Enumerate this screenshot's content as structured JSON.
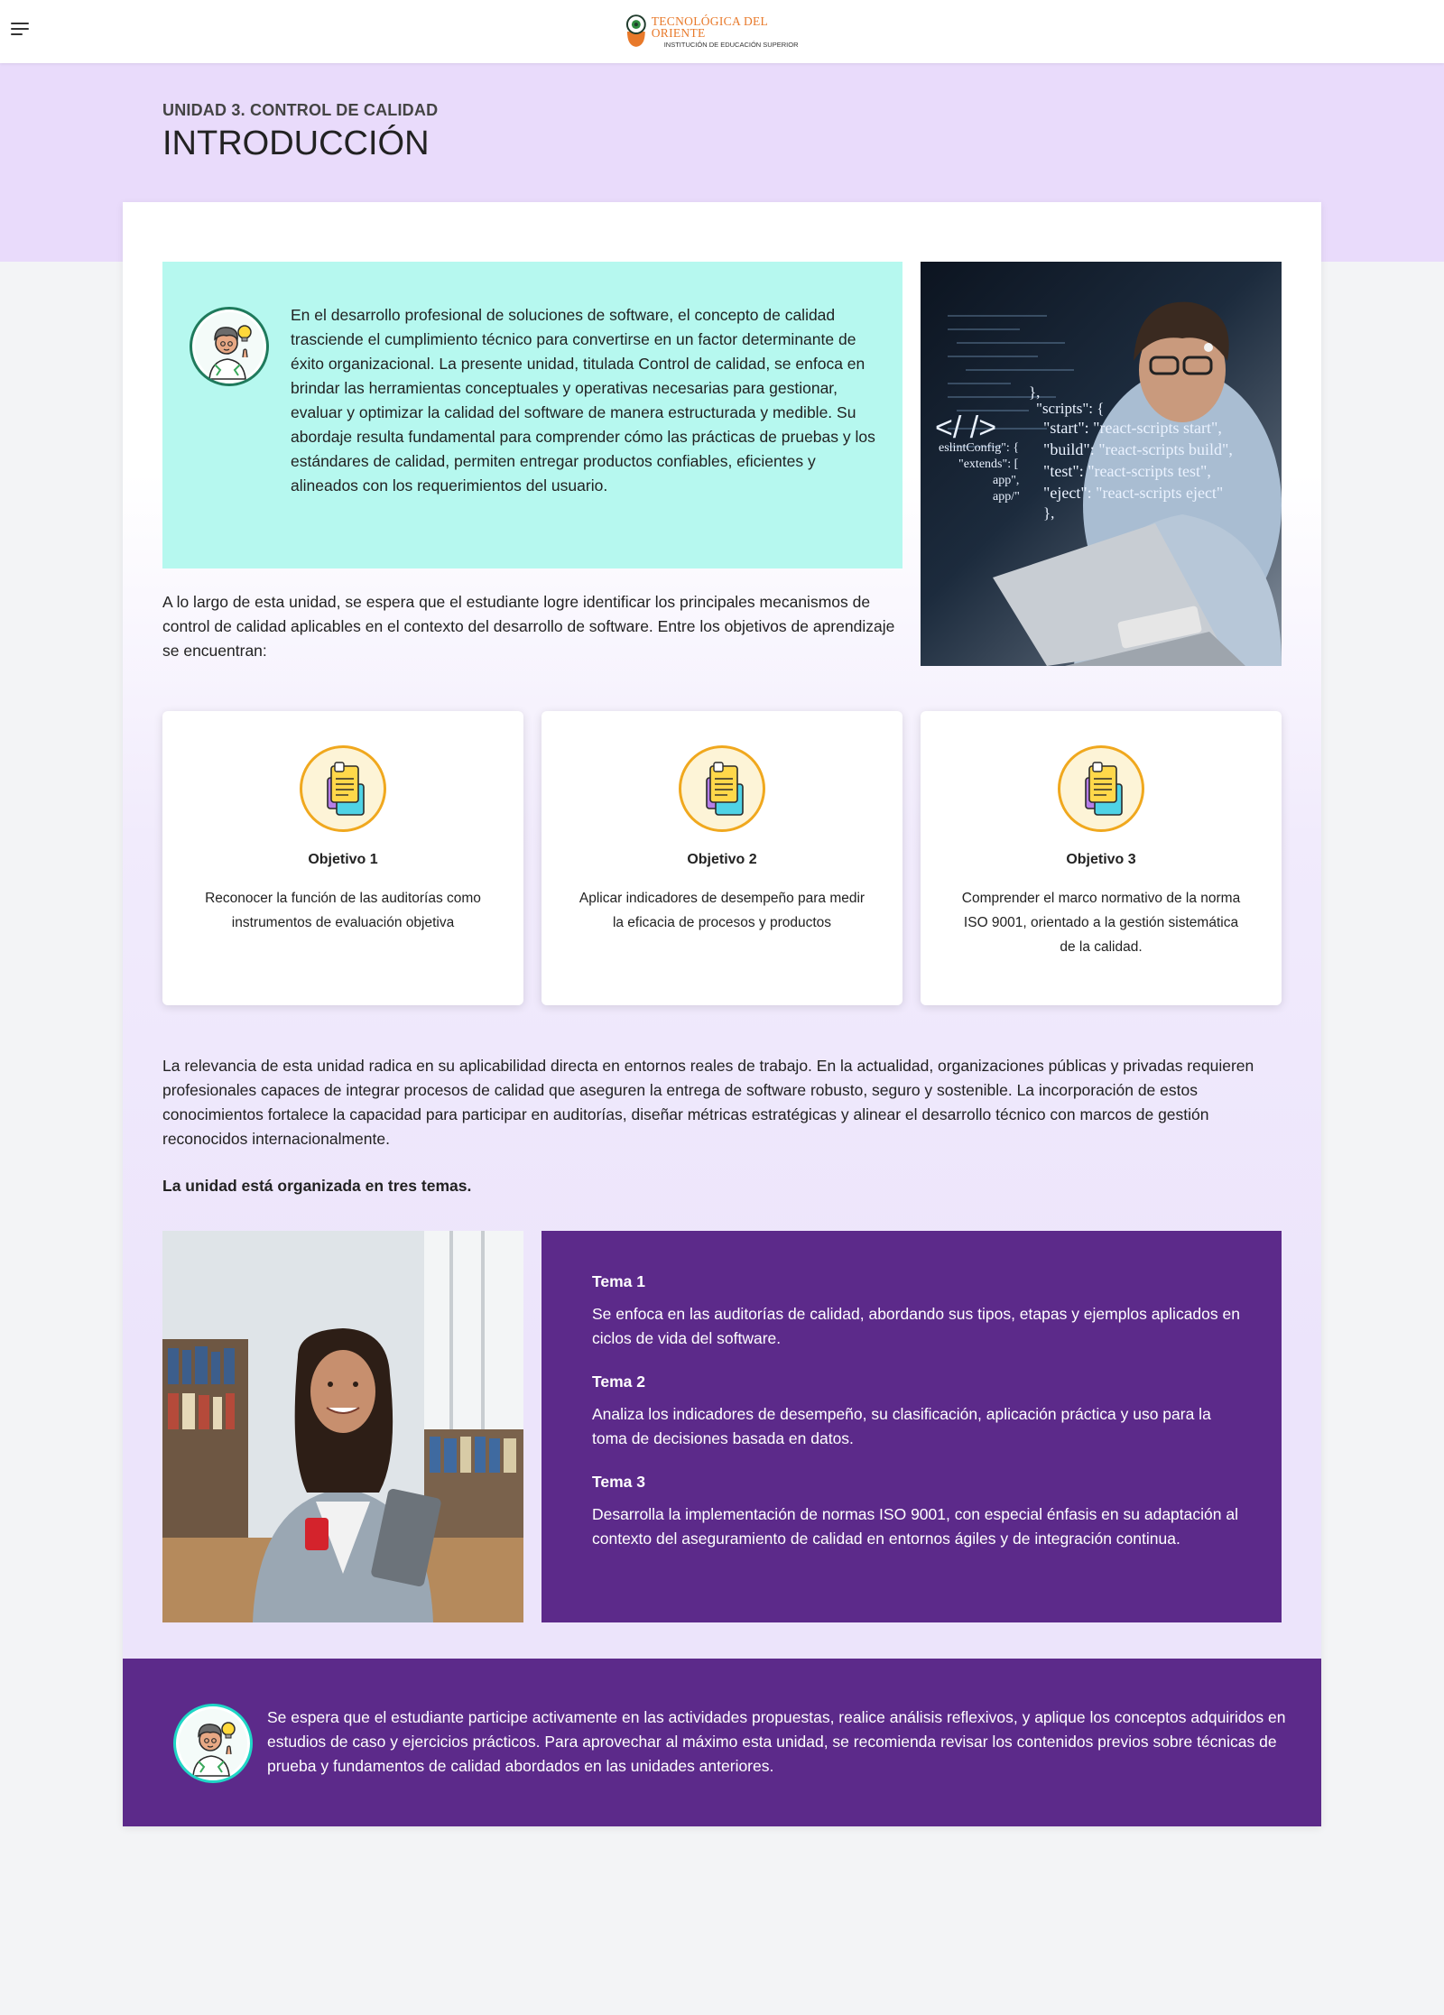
{
  "header": {
    "logo_title": "TECNOLÓGICA DEL ORIENTE",
    "logo_subtitle": "INSTITUCIÓN DE EDUCACIÓN SUPERIOR",
    "menu_icon": "hamburger-menu-icon"
  },
  "hero": {
    "unit": "UNIDAD 3. CONTROL DE CALIDAD",
    "title": "INTRODUCCIÓN"
  },
  "intro": {
    "paragraph_1": "En el desarrollo profesional de soluciones de software, el concepto de calidad trasciende el cumplimiento técnico para convertirse en un factor determinante de éxito organizacional. La presente unidad, titulada Control de calidad, se enfoca en brindar las herramientas conceptuales y operativas necesarias para gestionar, evaluar y optimizar la calidad del software de manera estructurada y medible. Su abordaje resulta fundamental para comprender cómo las prácticas de pruebas y los estándares de calidad, permiten entregar productos confiables, eficientes y alineados con los requerimientos del usuario.",
    "paragraph_2": "A lo largo de esta unidad, se espera que el estudiante logre identificar los principales mecanismos de control de calidad aplicables en el contexto del desarrollo de software. Entre los objetivos de aprendizaje se encuentran:",
    "code_lines": [
      "},",
      "\"scripts\": {",
      "\"start\": \"react-scripts start\",",
      "\"build\": \"react-scripts build\",",
      "\"test\": \"react-scripts test\",",
      "\"eject\": \"react-scripts eject\"",
      "},",
      "eslintConfig\": {",
      "\"extends\": [",
      "app\",",
      "app/\""
    ],
    "code_symbol": "</ />"
  },
  "objectives": [
    {
      "title": "Objetivo 1",
      "description": "Reconocer la función de las auditorías como instrumentos de evaluación objetiva"
    },
    {
      "title": "Objetivo 2",
      "description": "Aplicar indicadores de desempeño para medir la eficacia de procesos y productos"
    },
    {
      "title": "Objetivo 3",
      "description": "Comprender el marco normativo de la norma ISO 9001, orientado a la gestión sistemática de la calidad."
    }
  ],
  "relevance": "La relevancia de esta unidad radica en su aplicabilidad directa en entornos reales de trabajo. En la actualidad, organizaciones públicas y privadas requieren profesionales capaces de integrar procesos de calidad que aseguren la entrega de software robusto, seguro y sostenible. La incorporación de estos conocimientos fortalece la capacidad para participar en auditorías, diseñar métricas estratégicas y alinear el desarrollo técnico con marcos de gestión reconocidos internacionalmente.",
  "organized": "La unidad está organizada en tres temas.",
  "themes": [
    {
      "title": "Tema 1",
      "description": "Se enfoca en las auditorías de calidad, abordando sus tipos, etapas y ejemplos aplicados en ciclos de vida del software."
    },
    {
      "title": "Tema 2",
      "description": "Analiza los indicadores de desempeño, su clasificación, aplicación práctica y uso para la toma de decisiones basada en datos."
    },
    {
      "title": "Tema 3",
      "description": "Desarrolla la implementación de normas ISO 9001, con especial énfasis en su adaptación al contexto del aseguramiento de calidad en entornos ágiles y de integración continua."
    }
  ],
  "footer": {
    "text": "Se espera que el estudiante participe activamente en las actividades propuestas, realice análisis reflexivos, y aplique los conceptos adquiridos en estudios de caso y ejercicios prácticos. Para aprovechar al máximo esta unidad, se recomienda revisar los contenidos previos sobre técnicas de prueba y fundamentos de calidad abordados en las unidades anteriores."
  },
  "colors": {
    "hero_bg": "#e9dbfb",
    "intro_bg": "#b6f8ef",
    "theme_bg": "#5c2a8a",
    "accent_orange": "#e8792a",
    "objective_ring": "#f0a81e"
  }
}
